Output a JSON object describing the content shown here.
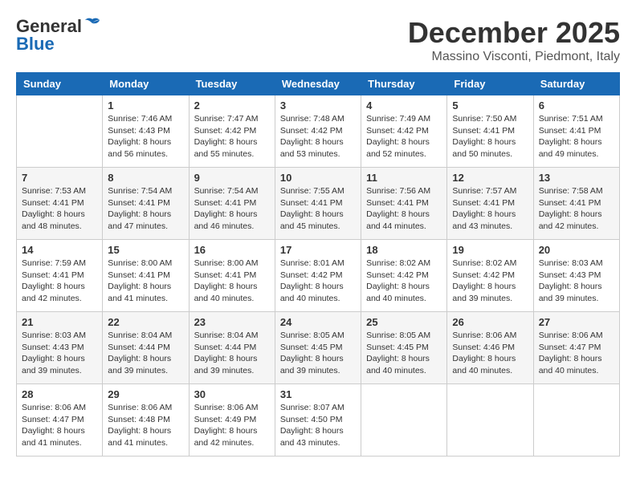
{
  "header": {
    "logo_general": "General",
    "logo_blue": "Blue",
    "month_title": "December 2025",
    "location": "Massino Visconti, Piedmont, Italy"
  },
  "weekdays": [
    "Sunday",
    "Monday",
    "Tuesday",
    "Wednesday",
    "Thursday",
    "Friday",
    "Saturday"
  ],
  "weeks": [
    [
      {
        "day": "",
        "sunrise": "",
        "sunset": "",
        "daylight": ""
      },
      {
        "day": "1",
        "sunrise": "Sunrise: 7:46 AM",
        "sunset": "Sunset: 4:43 PM",
        "daylight": "Daylight: 8 hours and 56 minutes."
      },
      {
        "day": "2",
        "sunrise": "Sunrise: 7:47 AM",
        "sunset": "Sunset: 4:42 PM",
        "daylight": "Daylight: 8 hours and 55 minutes."
      },
      {
        "day": "3",
        "sunrise": "Sunrise: 7:48 AM",
        "sunset": "Sunset: 4:42 PM",
        "daylight": "Daylight: 8 hours and 53 minutes."
      },
      {
        "day": "4",
        "sunrise": "Sunrise: 7:49 AM",
        "sunset": "Sunset: 4:42 PM",
        "daylight": "Daylight: 8 hours and 52 minutes."
      },
      {
        "day": "5",
        "sunrise": "Sunrise: 7:50 AM",
        "sunset": "Sunset: 4:41 PM",
        "daylight": "Daylight: 8 hours and 50 minutes."
      },
      {
        "day": "6",
        "sunrise": "Sunrise: 7:51 AM",
        "sunset": "Sunset: 4:41 PM",
        "daylight": "Daylight: 8 hours and 49 minutes."
      }
    ],
    [
      {
        "day": "7",
        "sunrise": "Sunrise: 7:53 AM",
        "sunset": "Sunset: 4:41 PM",
        "daylight": "Daylight: 8 hours and 48 minutes."
      },
      {
        "day": "8",
        "sunrise": "Sunrise: 7:54 AM",
        "sunset": "Sunset: 4:41 PM",
        "daylight": "Daylight: 8 hours and 47 minutes."
      },
      {
        "day": "9",
        "sunrise": "Sunrise: 7:54 AM",
        "sunset": "Sunset: 4:41 PM",
        "daylight": "Daylight: 8 hours and 46 minutes."
      },
      {
        "day": "10",
        "sunrise": "Sunrise: 7:55 AM",
        "sunset": "Sunset: 4:41 PM",
        "daylight": "Daylight: 8 hours and 45 minutes."
      },
      {
        "day": "11",
        "sunrise": "Sunrise: 7:56 AM",
        "sunset": "Sunset: 4:41 PM",
        "daylight": "Daylight: 8 hours and 44 minutes."
      },
      {
        "day": "12",
        "sunrise": "Sunrise: 7:57 AM",
        "sunset": "Sunset: 4:41 PM",
        "daylight": "Daylight: 8 hours and 43 minutes."
      },
      {
        "day": "13",
        "sunrise": "Sunrise: 7:58 AM",
        "sunset": "Sunset: 4:41 PM",
        "daylight": "Daylight: 8 hours and 42 minutes."
      }
    ],
    [
      {
        "day": "14",
        "sunrise": "Sunrise: 7:59 AM",
        "sunset": "Sunset: 4:41 PM",
        "daylight": "Daylight: 8 hours and 42 minutes."
      },
      {
        "day": "15",
        "sunrise": "Sunrise: 8:00 AM",
        "sunset": "Sunset: 4:41 PM",
        "daylight": "Daylight: 8 hours and 41 minutes."
      },
      {
        "day": "16",
        "sunrise": "Sunrise: 8:00 AM",
        "sunset": "Sunset: 4:41 PM",
        "daylight": "Daylight: 8 hours and 40 minutes."
      },
      {
        "day": "17",
        "sunrise": "Sunrise: 8:01 AM",
        "sunset": "Sunset: 4:42 PM",
        "daylight": "Daylight: 8 hours and 40 minutes."
      },
      {
        "day": "18",
        "sunrise": "Sunrise: 8:02 AM",
        "sunset": "Sunset: 4:42 PM",
        "daylight": "Daylight: 8 hours and 40 minutes."
      },
      {
        "day": "19",
        "sunrise": "Sunrise: 8:02 AM",
        "sunset": "Sunset: 4:42 PM",
        "daylight": "Daylight: 8 hours and 39 minutes."
      },
      {
        "day": "20",
        "sunrise": "Sunrise: 8:03 AM",
        "sunset": "Sunset: 4:43 PM",
        "daylight": "Daylight: 8 hours and 39 minutes."
      }
    ],
    [
      {
        "day": "21",
        "sunrise": "Sunrise: 8:03 AM",
        "sunset": "Sunset: 4:43 PM",
        "daylight": "Daylight: 8 hours and 39 minutes."
      },
      {
        "day": "22",
        "sunrise": "Sunrise: 8:04 AM",
        "sunset": "Sunset: 4:44 PM",
        "daylight": "Daylight: 8 hours and 39 minutes."
      },
      {
        "day": "23",
        "sunrise": "Sunrise: 8:04 AM",
        "sunset": "Sunset: 4:44 PM",
        "daylight": "Daylight: 8 hours and 39 minutes."
      },
      {
        "day": "24",
        "sunrise": "Sunrise: 8:05 AM",
        "sunset": "Sunset: 4:45 PM",
        "daylight": "Daylight: 8 hours and 39 minutes."
      },
      {
        "day": "25",
        "sunrise": "Sunrise: 8:05 AM",
        "sunset": "Sunset: 4:45 PM",
        "daylight": "Daylight: 8 hours and 40 minutes."
      },
      {
        "day": "26",
        "sunrise": "Sunrise: 8:06 AM",
        "sunset": "Sunset: 4:46 PM",
        "daylight": "Daylight: 8 hours and 40 minutes."
      },
      {
        "day": "27",
        "sunrise": "Sunrise: 8:06 AM",
        "sunset": "Sunset: 4:47 PM",
        "daylight": "Daylight: 8 hours and 40 minutes."
      }
    ],
    [
      {
        "day": "28",
        "sunrise": "Sunrise: 8:06 AM",
        "sunset": "Sunset: 4:47 PM",
        "daylight": "Daylight: 8 hours and 41 minutes."
      },
      {
        "day": "29",
        "sunrise": "Sunrise: 8:06 AM",
        "sunset": "Sunset: 4:48 PM",
        "daylight": "Daylight: 8 hours and 41 minutes."
      },
      {
        "day": "30",
        "sunrise": "Sunrise: 8:06 AM",
        "sunset": "Sunset: 4:49 PM",
        "daylight": "Daylight: 8 hours and 42 minutes."
      },
      {
        "day": "31",
        "sunrise": "Sunrise: 8:07 AM",
        "sunset": "Sunset: 4:50 PM",
        "daylight": "Daylight: 8 hours and 43 minutes."
      },
      {
        "day": "",
        "sunrise": "",
        "sunset": "",
        "daylight": ""
      },
      {
        "day": "",
        "sunrise": "",
        "sunset": "",
        "daylight": ""
      },
      {
        "day": "",
        "sunrise": "",
        "sunset": "",
        "daylight": ""
      }
    ]
  ]
}
